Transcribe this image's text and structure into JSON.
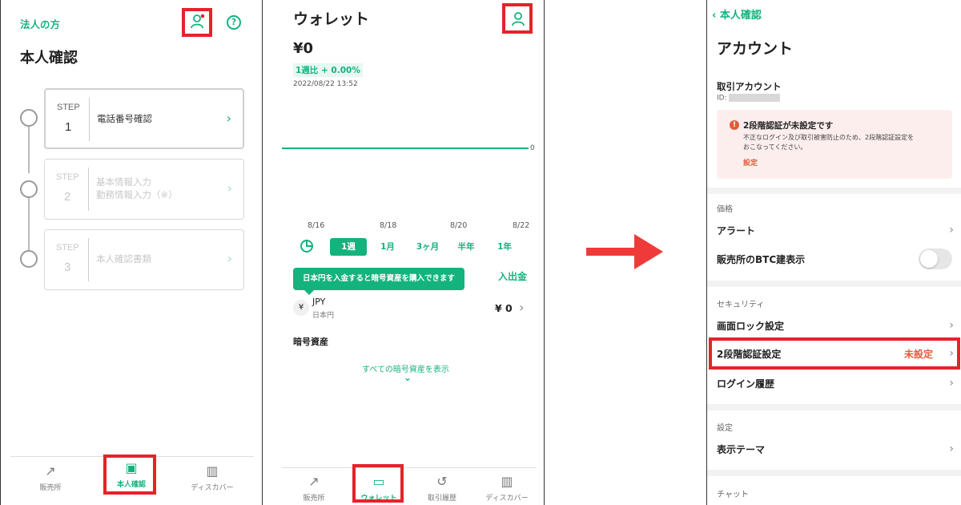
{
  "screen1": {
    "corp_link": "法人の方",
    "title": "本人確認",
    "steps": [
      {
        "label": "STEP",
        "num": "1",
        "text": "電話番号確認"
      },
      {
        "label": "STEP",
        "num": "2",
        "text_line1": "基本情報入力",
        "text_line2": "勤務情報入力（※）"
      },
      {
        "label": "STEP",
        "num": "3",
        "text": "本人確認書類"
      }
    ],
    "nav": [
      "販売所",
      "本人確認",
      "ディスカバー"
    ]
  },
  "screen2": {
    "title": "ウォレット",
    "balance": "¥0",
    "change": "1週比 + 0.00%",
    "timestamp": "2022/08/22 13:52",
    "chart_zero": "0",
    "x_labels": [
      "8/16",
      "8/18",
      "8/20",
      "8/22"
    ],
    "periods": [
      "1週",
      "1月",
      "3ヶ月",
      "半年",
      "1年"
    ],
    "deposit_link": "入出金",
    "tooltip": "日本円を入金すると暗号資産を購入できます",
    "jpy_code": "JPY",
    "jpy_name": "日本円",
    "jpy_amount": "¥ 0",
    "crypto_heading": "暗号資産",
    "show_all": "すべての暗号資産を表示",
    "nav": [
      "販売所",
      "ウォレット",
      "取引履歴",
      "ディスカバー"
    ]
  },
  "screen3": {
    "back": "本人確認",
    "title": "アカウント",
    "account_heading": "取引アカウント",
    "id_label": "ID:",
    "alert_title": "2段階認証が未設定です",
    "alert_body_1": "不正なログイン及び取引被害防止のため、2段階認証設定を",
    "alert_body_2": "おこなってください。",
    "alert_link": "設定",
    "sec_price": "価格",
    "alert_row": "アラート",
    "btc_row": "販売所のBTC建表示",
    "sec_security": "セキュリティ",
    "screen_lock": "画面ロック設定",
    "twofa": "2段階認証設定",
    "twofa_status": "未設定",
    "login_history": "ログイン履歴",
    "sec_settings": "設定",
    "theme": "表示テーマ",
    "sec_chat": "チャット"
  },
  "colors": {
    "accent": "#14b37d",
    "highlight": "#e4232b",
    "warning": "#e25b3b",
    "alert_bg": "#fdeeee"
  }
}
